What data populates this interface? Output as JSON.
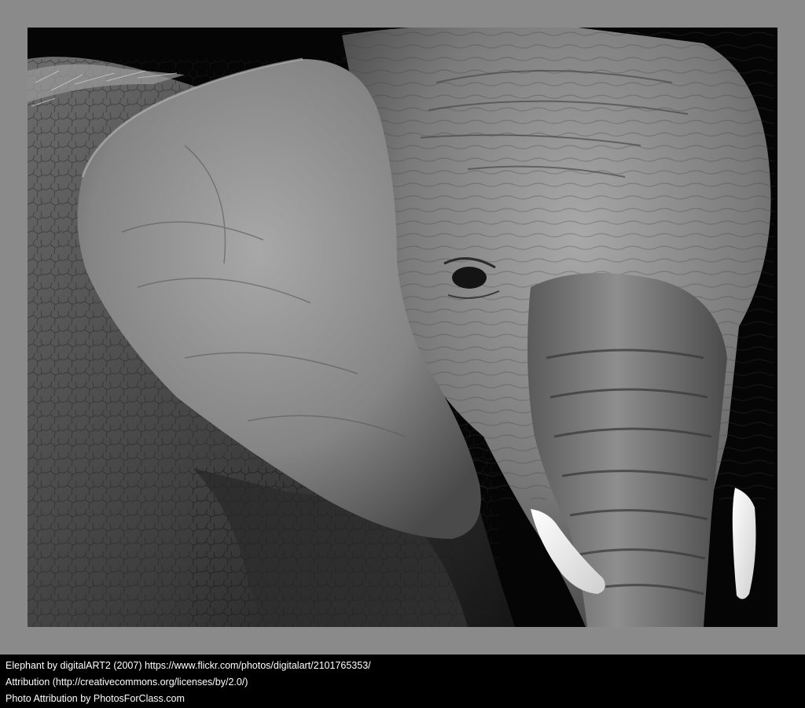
{
  "photo": {
    "subject": "elephant-head-closeup",
    "style": "black-and-white",
    "frame_color": "#8a8a8a",
    "background_color": "#050505"
  },
  "caption": {
    "line1": "Elephant by digitalART2 (2007) https://www.flickr.com/photos/digitalart/2101765353/",
    "line2": "Attribution (http://creativecommons.org/licenses/by/2.0/)",
    "line3": "Photo Attribution by PhotosForClass.com"
  }
}
